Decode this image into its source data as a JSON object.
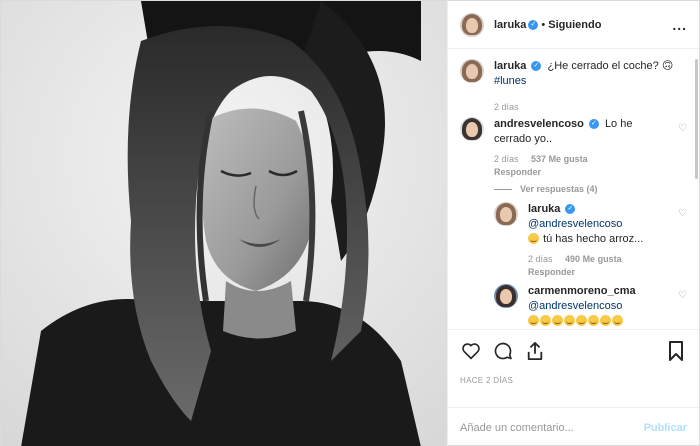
{
  "header": {
    "username": "laruka",
    "verified_mark": "✓",
    "separator": "•",
    "follow_status": "Siguiendo",
    "more": "..."
  },
  "caption": {
    "username": "laruka",
    "text": "¿He cerrado el coche? 🙃",
    "hashtag": "#lunes",
    "date": "2 días"
  },
  "comments": [
    {
      "username": "andresvelencoso",
      "text": "Lo he cerrado yo..",
      "date": "2 días",
      "likes": "537 Me gusta",
      "reply_label": "Responder",
      "view_replies": "Ver respuestas (4)"
    }
  ],
  "replies": [
    {
      "username": "laruka",
      "mention": "@andresvelencoso",
      "text": "tú has hecho arroz...",
      "date": "2 días",
      "likes": "490 Me gusta",
      "reply_label": "Responder"
    },
    {
      "username": "carmenmoreno_cma",
      "mention": "@andresvelencoso",
      "emoji_count": 8
    }
  ],
  "actions": {
    "timeago": "HACE 2 DÍAS",
    "icons": [
      "heart-icon",
      "comment-icon",
      "share-icon",
      "bookmark-icon"
    ]
  },
  "add_comment": {
    "placeholder": "Añade un comentario...",
    "publish": "Publicar"
  },
  "colors": {
    "link": "#003569",
    "verified": "#3897f0",
    "publish_disabled": "#b2dffc",
    "muted": "#999999"
  }
}
